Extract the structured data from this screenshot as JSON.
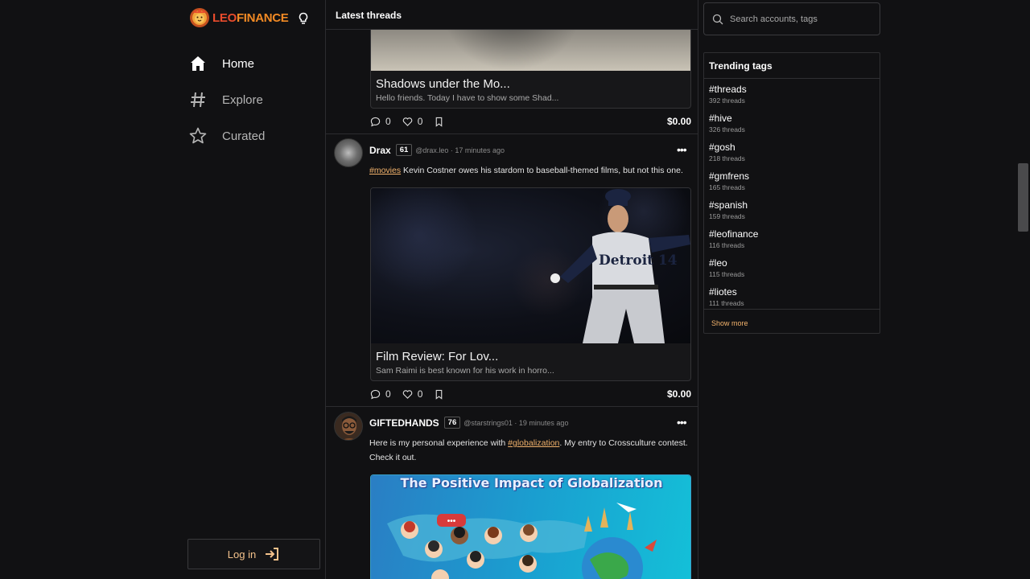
{
  "brand": {
    "leo": "LEO",
    "finance": "FINANCE"
  },
  "nav": {
    "home": "Home",
    "explore": "Explore",
    "curated": "Curated"
  },
  "login_label": "Log in",
  "feed": {
    "header": "Latest threads",
    "posts": [
      {
        "card_title": "Shadows under the Mo...",
        "card_desc": "Hello friends. Today I have to show some Shad...",
        "replies": "0",
        "likes": "0",
        "amount": "$0.00"
      },
      {
        "author": "Drax",
        "reputation": "61",
        "handle_time": "@drax.leo  ·  17 minutes ago",
        "tag": "#movies",
        "text": " Kevin Costner owes his stardom to baseball-themed films, but not this one.",
        "card_title": "Film Review: For Lov...",
        "card_desc": "Sam Raimi is best known for his work in horro...",
        "image_caption": "Detroit 14",
        "replies": "0",
        "likes": "0",
        "amount": "$0.00"
      },
      {
        "author": "GIFTEDHANDS",
        "reputation": "76",
        "handle_time": "@starstrings01  ·  19 minutes ago",
        "text_before": "Here is my personal experience with ",
        "tag": "#globalization",
        "text_after": ". My entry to Crossculture contest. Check it out.",
        "image_title": "The Positive Impact of Globalization"
      }
    ]
  },
  "search": {
    "placeholder": "Search accounts, tags"
  },
  "trending": {
    "title": "Trending tags",
    "tags": [
      {
        "name": "#threads",
        "count": "392 threads"
      },
      {
        "name": "#hive",
        "count": "326 threads"
      },
      {
        "name": "#gosh",
        "count": "218 threads"
      },
      {
        "name": "#gmfrens",
        "count": "165 threads"
      },
      {
        "name": "#spanish",
        "count": "159 threads"
      },
      {
        "name": "#leofinance",
        "count": "116 threads"
      },
      {
        "name": "#leo",
        "count": "115 threads"
      },
      {
        "name": "#liotes",
        "count": "111 threads"
      }
    ],
    "show_more": "Show more"
  },
  "colors": {
    "accent": "#f3b36c",
    "brand_red": "#e84b2c",
    "brand_orange": "#f28a24",
    "background": "#111113"
  },
  "icons": [
    "lion-logo-icon",
    "lightbulb-icon",
    "home-icon",
    "hash-icon",
    "star-icon",
    "login-arrow-icon",
    "comment-icon",
    "heart-icon",
    "bookmark-icon",
    "more-icon",
    "search-icon"
  ]
}
